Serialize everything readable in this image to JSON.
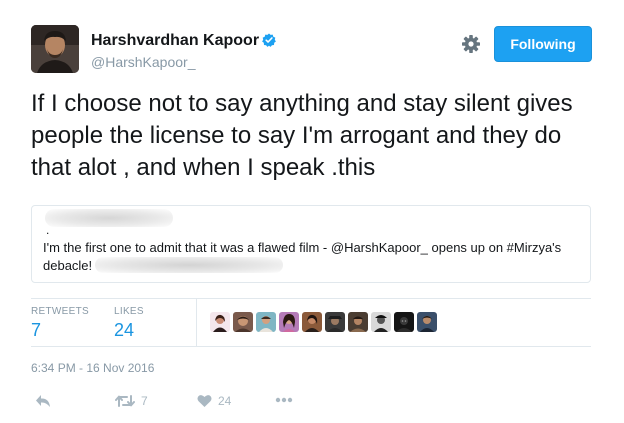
{
  "author": {
    "name": "Harshvardhan Kapoor",
    "handle": "@HarshKapoor_",
    "verified": true
  },
  "follow_button": {
    "label": "Following"
  },
  "tweet": {
    "text": "If I choose not to say anything and stay silent gives people the license to say I'm arrogant and they do that alot , and when I speak .this"
  },
  "quoted": {
    "dot": ".",
    "text": "I'm the first one to admit that it was a flawed film - @HarshKapoor_ opens up on #Mirzya's debacle!"
  },
  "stats": {
    "retweets_label": "RETWEETS",
    "retweets": "7",
    "likes_label": "LIKES",
    "likes": "24"
  },
  "timestamp": "6:34 PM - 16 Nov 2016",
  "actions": {
    "retweet_count": "7",
    "like_count": "24"
  },
  "colors": {
    "accent": "#1da1f2",
    "link": "#1b95e0",
    "muted": "#8899a6",
    "border": "#e1e8ed"
  }
}
